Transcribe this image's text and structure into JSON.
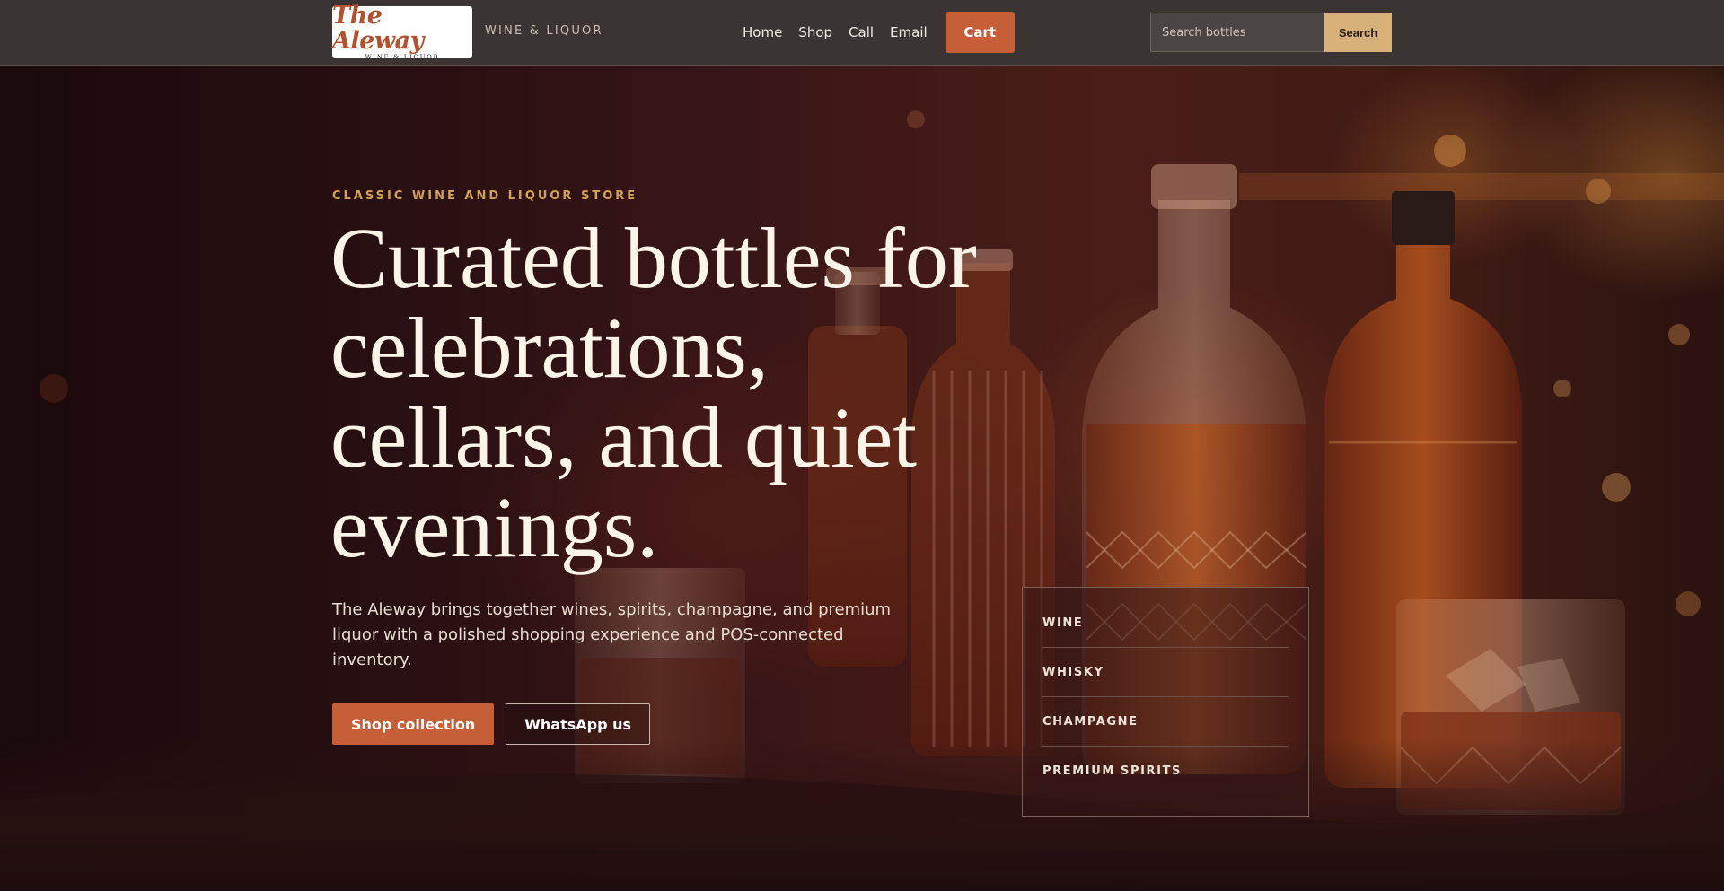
{
  "header": {
    "logo": {
      "name": "The Aleway",
      "sub": "WINE & LIQUOR"
    },
    "tagline": "WINE & LIQUOR",
    "nav": [
      {
        "label": "Home"
      },
      {
        "label": "Shop"
      },
      {
        "label": "Call"
      },
      {
        "label": "Email"
      }
    ],
    "cart_label": "Cart",
    "search": {
      "placeholder": "Search bottles",
      "button_label": "Search"
    }
  },
  "hero": {
    "eyebrow": "CLASSIC WINE AND LIQUOR STORE",
    "headline": "Curated bottles for celebrations, cellars, and quiet evenings.",
    "lede": "The Aleway brings together wines, spirits, champagne, and premium liquor with a polished shopping experience and POS-connected inventory.",
    "primary_cta": "Shop collection",
    "secondary_cta": "WhatsApp us"
  },
  "categories": [
    {
      "label": "WINE"
    },
    {
      "label": "WHISKY"
    },
    {
      "label": "CHAMPAGNE"
    },
    {
      "label": "PREMIUM SPIRITS"
    }
  ],
  "colors": {
    "accent": "#c65f38",
    "gold": "#d2a15a",
    "header_bg": "#3a3432",
    "search_button": "#d7b07a"
  }
}
